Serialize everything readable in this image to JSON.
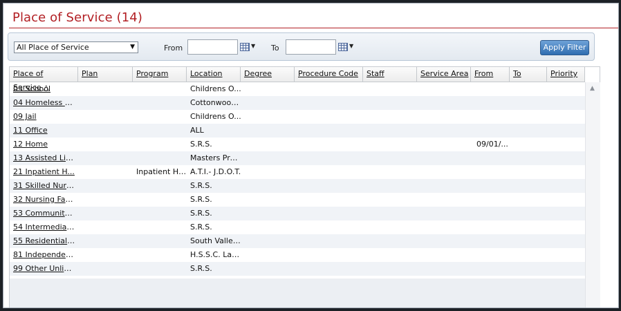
{
  "page": {
    "title": "Place of Service (14)"
  },
  "filter": {
    "place_select_value": "All Place of Service",
    "from_label": "From",
    "to_label": "To",
    "from_value": "",
    "to_value": "",
    "apply_label": "Apply Filter"
  },
  "table": {
    "columns": [
      "Place of Service",
      "Plan",
      "Program",
      "Location",
      "Degree",
      "Procedure Code",
      "Staff",
      "Service Area",
      "From",
      "To",
      "Priority"
    ],
    "sort_indicator": "△",
    "rows": [
      {
        "place": "03 School",
        "plan": "",
        "program": "",
        "location": "Childrens O...",
        "from": ""
      },
      {
        "place": "04 Homeless S...",
        "plan": "",
        "program": "",
        "location": "Cottonwood...",
        "from": ""
      },
      {
        "place": "09 Jail",
        "plan": "",
        "program": "",
        "location": "Childrens O...",
        "from": ""
      },
      {
        "place": "11 Office",
        "plan": "",
        "program": "",
        "location": "ALL",
        "from": ""
      },
      {
        "place": "12 Home",
        "plan": "",
        "program": "",
        "location": "S.R.S.",
        "from": "09/01/..."
      },
      {
        "place": "13 Assisted Liv...",
        "plan": "",
        "program": "",
        "location": "Masters Pro...",
        "from": ""
      },
      {
        "place": "21 Inpatient H...",
        "plan": "",
        "program": "Inpatient Ho...",
        "location": "A.T.I.- J.D.O.T.",
        "from": ""
      },
      {
        "place": "31 Skilled Nurs...",
        "plan": "",
        "program": "",
        "location": "S.R.S.",
        "from": ""
      },
      {
        "place": "32 Nursing Fac...",
        "plan": "",
        "program": "",
        "location": "S.R.S.",
        "from": ""
      },
      {
        "place": "53 Community ...",
        "plan": "",
        "program": "",
        "location": "S.R.S.",
        "from": ""
      },
      {
        "place": "54 Intermediat...",
        "plan": "",
        "program": "",
        "location": "S.R.S.",
        "from": ""
      },
      {
        "place": "55 Residential ...",
        "plan": "",
        "program": "",
        "location": "South Valley...",
        "from": ""
      },
      {
        "place": "81 Independen...",
        "plan": "",
        "program": "",
        "location": "H.S.S.C. Lab ...",
        "from": ""
      },
      {
        "place": "99 Other Unlist...",
        "plan": "",
        "program": "",
        "location": "S.R.S.",
        "from": ""
      }
    ]
  },
  "icons": {
    "dropdown": "triangle-down",
    "calendar": "calendar-grid",
    "scroll_up": "triangle-up"
  },
  "colors": {
    "title": "#b21f24",
    "button": "#2f6db0"
  }
}
